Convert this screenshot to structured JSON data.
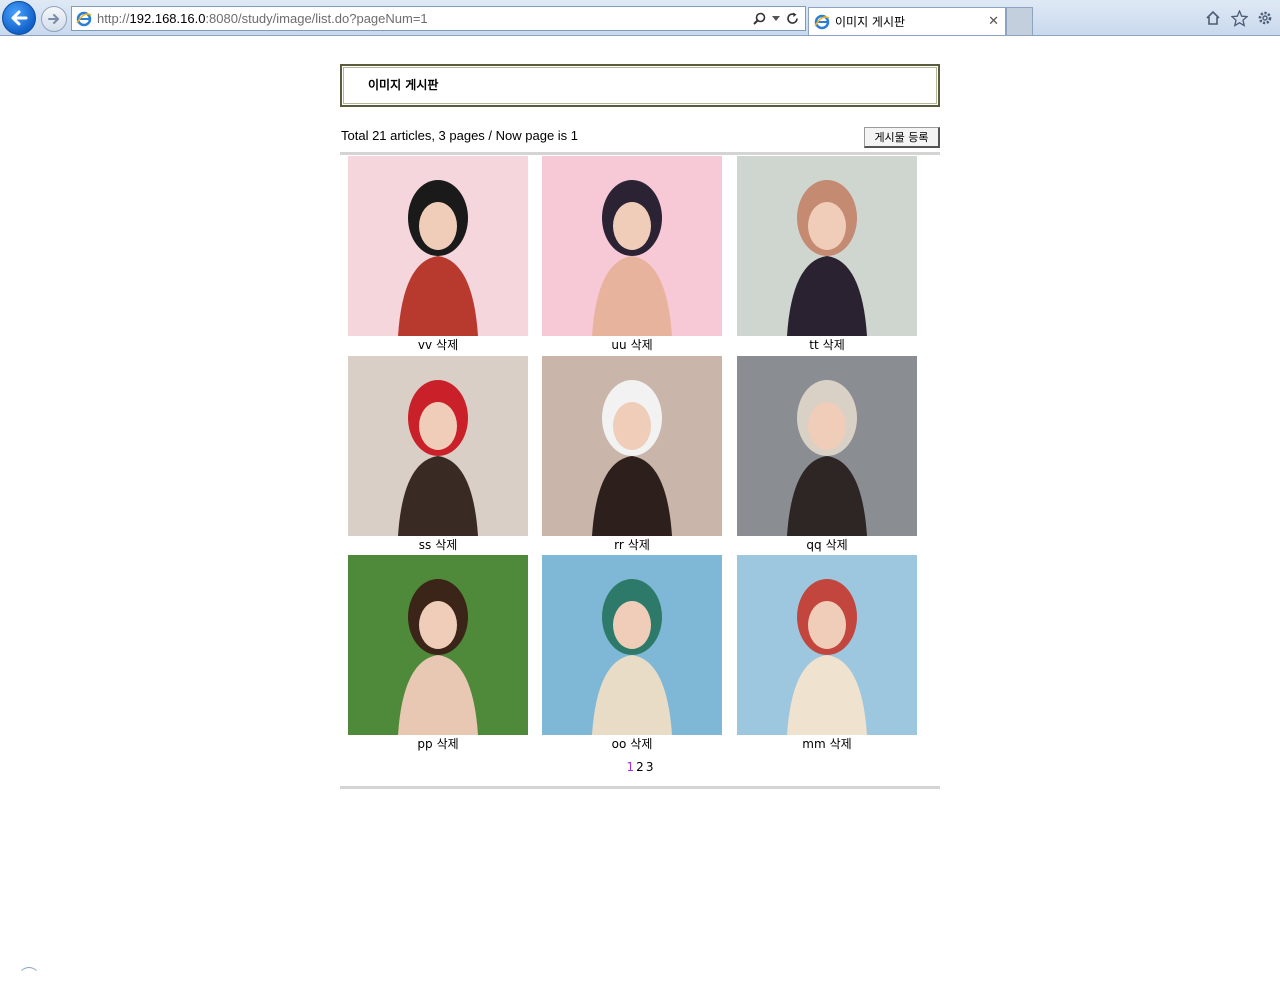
{
  "browser": {
    "url_prefix": "http://",
    "url_host": "192.168.16.0",
    "url_rest": ":8080/study/image/list.do?pageNum=1",
    "tab_title": "이미지 게시판",
    "icons": [
      "back-arrow-icon",
      "forward-arrow-icon",
      "ie-logo-icon",
      "search-icon",
      "dropdown-icon",
      "refresh-icon",
      "close-icon",
      "home-icon",
      "favorites-star-icon",
      "settings-gear-icon"
    ]
  },
  "board": {
    "title": "이미지 게시판",
    "summary": "Total 21 articles, 3 pages / Now page is 1",
    "write_button": "게시물 등록",
    "delete_label": "삭제",
    "items": [
      {
        "name": "vv",
        "palette": [
          "#f5d6dc",
          "#b83a2e",
          "#1a1a1a"
        ]
      },
      {
        "name": "uu",
        "palette": [
          "#f7c9d6",
          "#e8b39c",
          "#2b2233"
        ]
      },
      {
        "name": "tt",
        "palette": [
          "#cfd6cf",
          "#2a2230",
          "#c48a72"
        ]
      },
      {
        "name": "ss",
        "palette": [
          "#d9cfc7",
          "#3a2a24",
          "#c9202a"
        ]
      },
      {
        "name": "rr",
        "palette": [
          "#c9b5aa",
          "#2c1f1c",
          "#f2f2f2"
        ]
      },
      {
        "name": "qq",
        "palette": [
          "#8a8e93",
          "#2e2624",
          "#d9d1c5"
        ]
      },
      {
        "name": "pp",
        "palette": [
          "#4f8a3a",
          "#e8c8b2",
          "#3b2418"
        ]
      },
      {
        "name": "oo",
        "palette": [
          "#7fb8d6",
          "#e8dcc6",
          "#2e7a6a"
        ]
      },
      {
        "name": "mm",
        "palette": [
          "#9cc7df",
          "#efe3cf",
          "#c2463e"
        ]
      }
    ],
    "pages": [
      "1",
      "2",
      "3"
    ],
    "current_page": "1",
    "colors": {
      "current_page": "#9b2fd1",
      "header_border": "#5a5a3c",
      "rule": "#d4d4d4"
    }
  }
}
